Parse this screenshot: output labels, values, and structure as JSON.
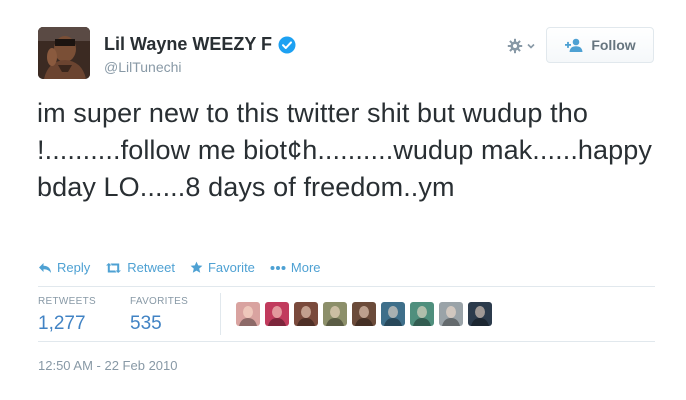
{
  "author": {
    "fullname": "Lil Wayne WEEZY F",
    "username": "@LilTunechi",
    "verified": true,
    "avatar_icon": "profile-photo"
  },
  "header": {
    "gear_icon": "gear-icon",
    "follow_label": "Follow"
  },
  "tweet": {
    "text": "im super new to this twitter shit but wudup tho !..........follow me biot¢h..........wudup mak......happy bday LO......8 days of freedom..ym"
  },
  "actions": {
    "reply": "Reply",
    "retweet": "Retweet",
    "favorite": "Favorite",
    "more": "More"
  },
  "stats": {
    "retweets_label": "RETWEETS",
    "retweets_value": "1,277",
    "favorites_label": "FAVORITES",
    "favorites_value": "535"
  },
  "favoriters": [
    {
      "name": "favoriter-1",
      "color": "#d9a3a0"
    },
    {
      "name": "favoriter-2",
      "color": "#c13b5d"
    },
    {
      "name": "favoriter-3",
      "color": "#7a4a3c"
    },
    {
      "name": "favoriter-4",
      "color": "#8c8f6a"
    },
    {
      "name": "favoriter-5",
      "color": "#6b4b3a"
    },
    {
      "name": "favoriter-6",
      "color": "#3e6f8a"
    },
    {
      "name": "favoriter-7",
      "color": "#4f8f7d"
    },
    {
      "name": "favoriter-8",
      "color": "#9aa3a8"
    },
    {
      "name": "favoriter-9",
      "color": "#2c3b4c"
    }
  ],
  "timestamp": "12:50 AM - 22 Feb 2010",
  "colors": {
    "link_blue": "#4ea1d3",
    "stat_blue": "#4183c4",
    "verified_blue": "#1da1f2",
    "muted_gray": "#8899a6"
  }
}
